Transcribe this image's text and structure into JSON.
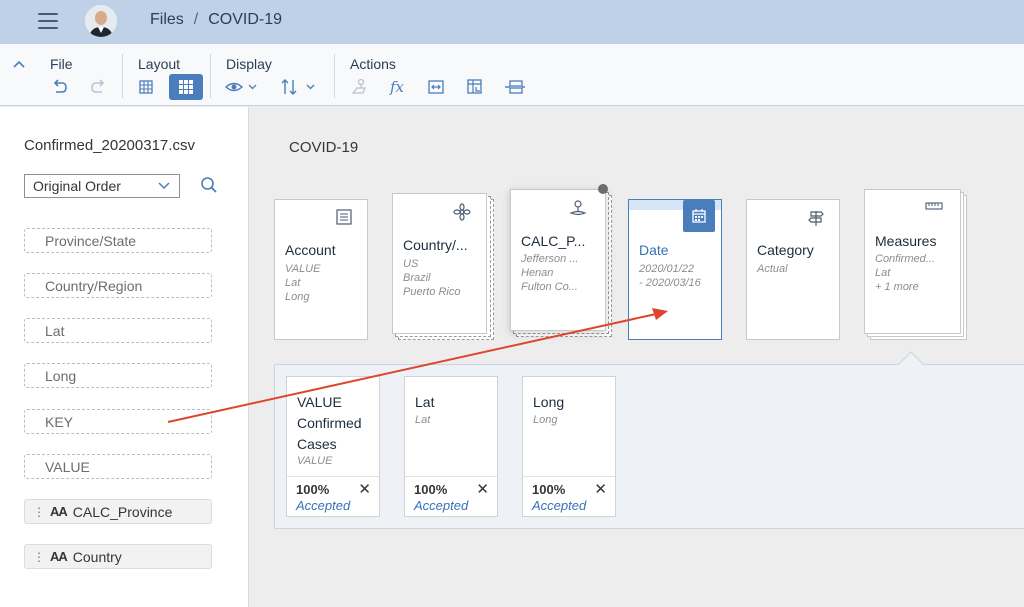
{
  "shell": {
    "breadcrumb_root": "Files",
    "breadcrumb_sep": "/",
    "breadcrumb_current": "COVID-19"
  },
  "toolbar": {
    "file_label": "File",
    "layout_label": "Layout",
    "display_label": "Display",
    "actions_label": "Actions"
  },
  "left_panel": {
    "file_name": "Confirmed_20200317.csv",
    "order_value": "Original Order",
    "fields": [
      "Province/State",
      "Country/Region",
      "Lat",
      "Long",
      "KEY",
      "VALUE"
    ],
    "calc_fields": [
      "CALC_Province",
      "Country"
    ]
  },
  "main": {
    "title": "COVID-19",
    "cards": [
      {
        "title": "Account",
        "meta": [
          "VALUE",
          "Lat",
          "Long"
        ],
        "icon": "account-hierarchy-icon"
      },
      {
        "title": "Country/...",
        "meta": [
          "US",
          "Brazil",
          "Puerto Rico"
        ],
        "icon": "country-flower-icon"
      },
      {
        "title": "CALC_P...",
        "meta": [
          "Jefferson ...",
          "Henan",
          "Fulton Co..."
        ],
        "icon": "location-pin-icon"
      },
      {
        "title": "Date",
        "meta": [
          "2020/01/22",
          "- 2020/03/16"
        ],
        "icon": "calendar-icon"
      },
      {
        "title": "Category",
        "meta": [
          "Actual"
        ],
        "icon": "signpost-icon"
      },
      {
        "title": "Measures",
        "meta": [
          "Confirmed...",
          "Lat",
          "+ 1 more"
        ],
        "icon": "ruler-icon"
      }
    ],
    "measures": [
      {
        "title_lines": [
          "VALUE",
          "Confirmed",
          "Cases"
        ],
        "sub": "VALUE",
        "pct": "100%",
        "status": "Accepted"
      },
      {
        "title_lines": [
          "Lat"
        ],
        "sub": "Lat",
        "pct": "100%",
        "status": "Accepted"
      },
      {
        "title_lines": [
          "Long"
        ],
        "sub": "Long",
        "pct": "100%",
        "status": "Accepted"
      }
    ]
  },
  "colors": {
    "shell": "#bfd1e6",
    "accent": "#4a7dbb",
    "arrow": "#e0442c"
  }
}
